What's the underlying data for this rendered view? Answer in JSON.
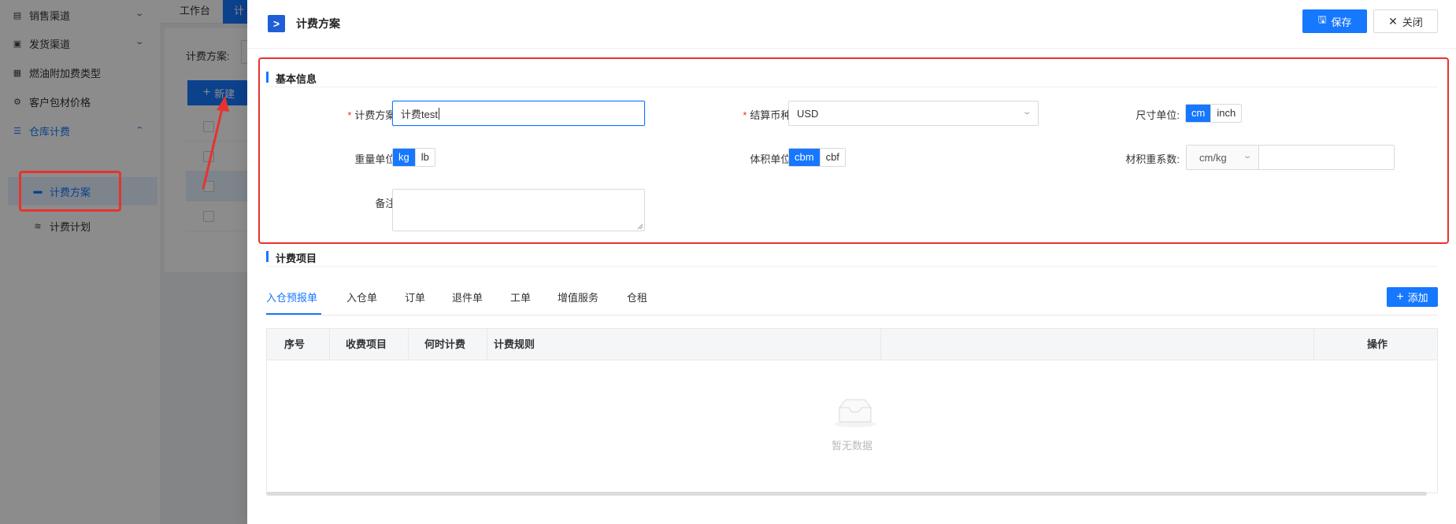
{
  "sidebar": {
    "items": [
      {
        "label": "销售渠道",
        "icon": "list-icon",
        "has_chevron": true
      },
      {
        "label": "发货渠道",
        "icon": "box-icon",
        "has_chevron": true
      },
      {
        "label": "燃油附加费类型",
        "icon": "calendar-icon",
        "has_chevron": false
      },
      {
        "label": "客户包材价格",
        "icon": "settings-icon",
        "has_chevron": false
      },
      {
        "label": "仓库计费",
        "icon": "sliders-icon",
        "has_chevron": true,
        "expanded": true
      },
      {
        "label": "计费方案",
        "icon": "ticket-icon",
        "active": true
      },
      {
        "label": "计费计划",
        "icon": "stack-icon"
      }
    ]
  },
  "background": {
    "tabs": [
      {
        "label": "工作台"
      },
      {
        "label": "计"
      }
    ],
    "filter_label": "计费方案:",
    "new_button_label": "新建"
  },
  "drawer": {
    "title": "计费方案",
    "save_label": "保存",
    "close_label": "关闭",
    "basic_info_title": "基本信息",
    "fields": {
      "scheme_label": "计费方案:",
      "scheme_value": "计费test",
      "currency_label": "结算币种:",
      "currency_value": "USD",
      "size_unit_label": "尺寸单位:",
      "size_unit_options": [
        "cm",
        "inch"
      ],
      "size_unit_selected": "cm",
      "weight_unit_label": "重量单位:",
      "weight_unit_options": [
        "kg",
        "lb"
      ],
      "weight_unit_selected": "kg",
      "volume_unit_label": "体积单位:",
      "volume_unit_options": [
        "cbm",
        "cbf"
      ],
      "volume_unit_selected": "cbm",
      "volumetric_label": "材积重系数:",
      "volumetric_unit": "cm/kg",
      "volumetric_value": "",
      "remark_label": "备注:",
      "remark_value": ""
    },
    "billing_items_title": "计费项目",
    "tabs": [
      {
        "label": "入仓预报单",
        "active": true
      },
      {
        "label": "入仓单"
      },
      {
        "label": "订单"
      },
      {
        "label": "退件单"
      },
      {
        "label": "工单"
      },
      {
        "label": "增值服务"
      },
      {
        "label": "仓租"
      }
    ],
    "add_label": "添加",
    "table": {
      "columns": [
        "序号",
        "收费项目",
        "何时计费",
        "计费规则",
        "操作"
      ],
      "rows": [],
      "empty_text": "暂无数据"
    }
  },
  "colors": {
    "primary": "#1677ff",
    "annotation_red": "#e8322f"
  }
}
